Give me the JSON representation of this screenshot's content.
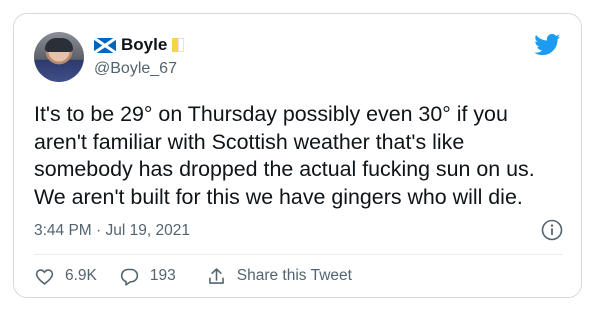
{
  "tweet": {
    "display_name": "Boyle",
    "handle": "@Boyle_67",
    "text": "It's to be 29° on Thursday possibly even 30° if you\naren't familiar with Scottish weather that's like\nsomebody has dropped the actual fucking sun on us.\nWe aren't built for this we have gingers who will die.",
    "timestamp": "3:44 PM · Jul 19, 2021"
  },
  "actions": {
    "likes": "6.9K",
    "replies": "193",
    "share_label": "Share this Tweet"
  },
  "colors": {
    "twitter_blue": "#1d9bf0",
    "secondary_text": "#536471",
    "scotland_flag_blue": "#0065bd"
  },
  "icons": {
    "name_badges": [
      "scotland-flag-icon",
      "vatican-flag-icon"
    ],
    "brand": "twitter-bird-icon",
    "info": "info-icon",
    "like": "heart-icon",
    "reply": "reply-bubble-icon",
    "share": "share-icon"
  }
}
